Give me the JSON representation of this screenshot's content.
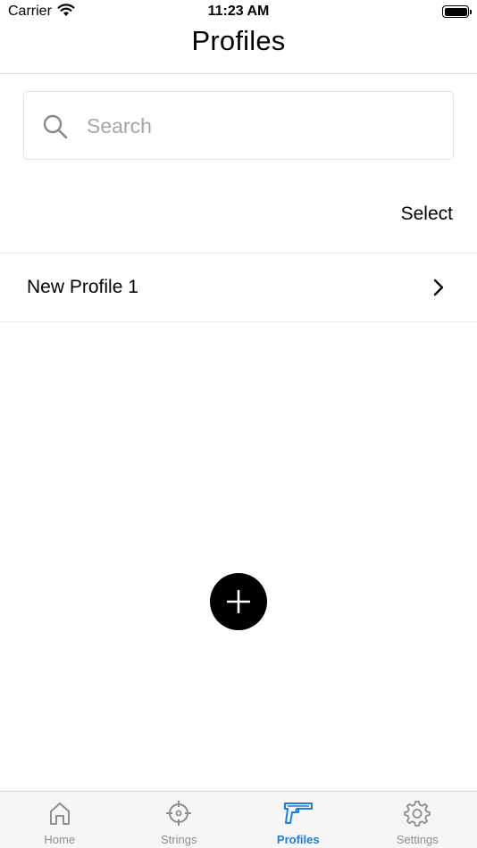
{
  "status_bar": {
    "carrier": "Carrier",
    "time": "11:23 AM",
    "wifi_icon": "wifi-icon",
    "battery_icon": "battery-icon"
  },
  "nav": {
    "title": "Profiles"
  },
  "search": {
    "placeholder": "Search",
    "value": "",
    "icon": "search-icon"
  },
  "actions": {
    "select_label": "Select"
  },
  "profiles": [
    {
      "name": "New Profile 1",
      "icon": "chevron-right-icon"
    }
  ],
  "fab": {
    "icon": "plus-icon"
  },
  "tab_bar": {
    "active_color": "#1a7fe0",
    "inactive_color": "#8e8e8e",
    "tabs": [
      {
        "label": "Home",
        "icon": "home-icon",
        "active": false
      },
      {
        "label": "Strings",
        "icon": "crosshair-icon",
        "active": false
      },
      {
        "label": "Profiles",
        "icon": "pistol-icon",
        "active": true
      },
      {
        "label": "Settings",
        "icon": "gear-icon",
        "active": false
      }
    ]
  }
}
